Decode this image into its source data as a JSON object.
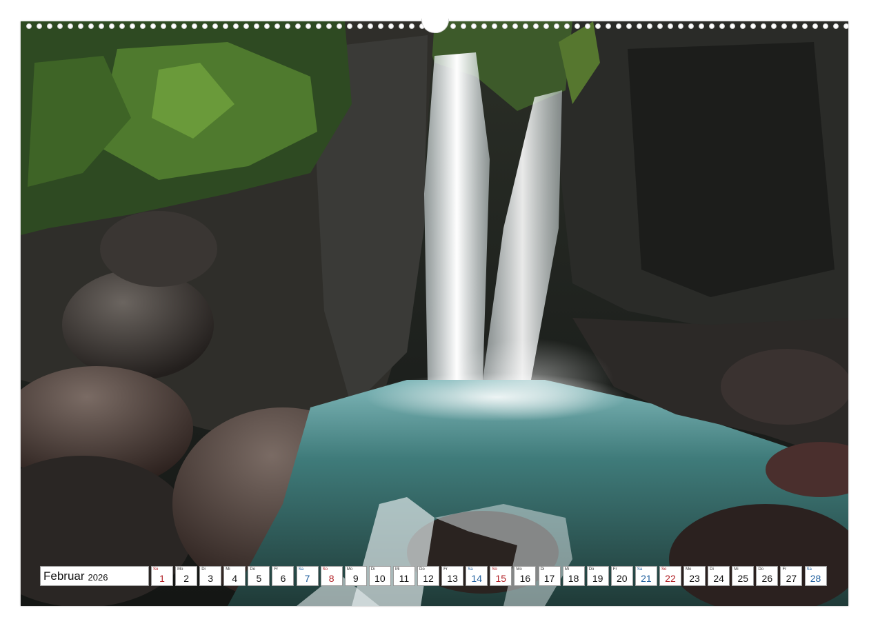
{
  "calendar": {
    "month": "Februar",
    "year": "2026",
    "days": [
      {
        "wd": "So",
        "d": "1",
        "type": "sun"
      },
      {
        "wd": "Mo",
        "d": "2",
        "type": "wk"
      },
      {
        "wd": "Di",
        "d": "3",
        "type": "wk"
      },
      {
        "wd": "Mi",
        "d": "4",
        "type": "wk"
      },
      {
        "wd": "Do",
        "d": "5",
        "type": "wk"
      },
      {
        "wd": "Fr",
        "d": "6",
        "type": "wk"
      },
      {
        "wd": "Sa",
        "d": "7",
        "type": "sat"
      },
      {
        "wd": "So",
        "d": "8",
        "type": "sun"
      },
      {
        "wd": "Mo",
        "d": "9",
        "type": "wk"
      },
      {
        "wd": "Di",
        "d": "10",
        "type": "wk"
      },
      {
        "wd": "Mi",
        "d": "11",
        "type": "wk"
      },
      {
        "wd": "Do",
        "d": "12",
        "type": "wk"
      },
      {
        "wd": "Fr",
        "d": "13",
        "type": "wk"
      },
      {
        "wd": "Sa",
        "d": "14",
        "type": "sat"
      },
      {
        "wd": "So",
        "d": "15",
        "type": "sun"
      },
      {
        "wd": "Mo",
        "d": "16",
        "type": "wk"
      },
      {
        "wd": "Di",
        "d": "17",
        "type": "wk"
      },
      {
        "wd": "Mi",
        "d": "18",
        "type": "wk"
      },
      {
        "wd": "Do",
        "d": "19",
        "type": "wk"
      },
      {
        "wd": "Fr",
        "d": "20",
        "type": "wk"
      },
      {
        "wd": "Sa",
        "d": "21",
        "type": "sat"
      },
      {
        "wd": "So",
        "d": "22",
        "type": "sun"
      },
      {
        "wd": "Mo",
        "d": "23",
        "type": "wk"
      },
      {
        "wd": "Di",
        "d": "24",
        "type": "wk"
      },
      {
        "wd": "Mi",
        "d": "25",
        "type": "wk"
      },
      {
        "wd": "Do",
        "d": "26",
        "type": "wk"
      },
      {
        "wd": "Fr",
        "d": "27",
        "type": "wk"
      },
      {
        "wd": "Sa",
        "d": "28",
        "type": "sat"
      }
    ]
  },
  "colors": {
    "saturday": "#1f5f9e",
    "sunday": "#b01e23",
    "weekday": "#111111"
  },
  "photo": {
    "icon": "waterfall-photo"
  }
}
